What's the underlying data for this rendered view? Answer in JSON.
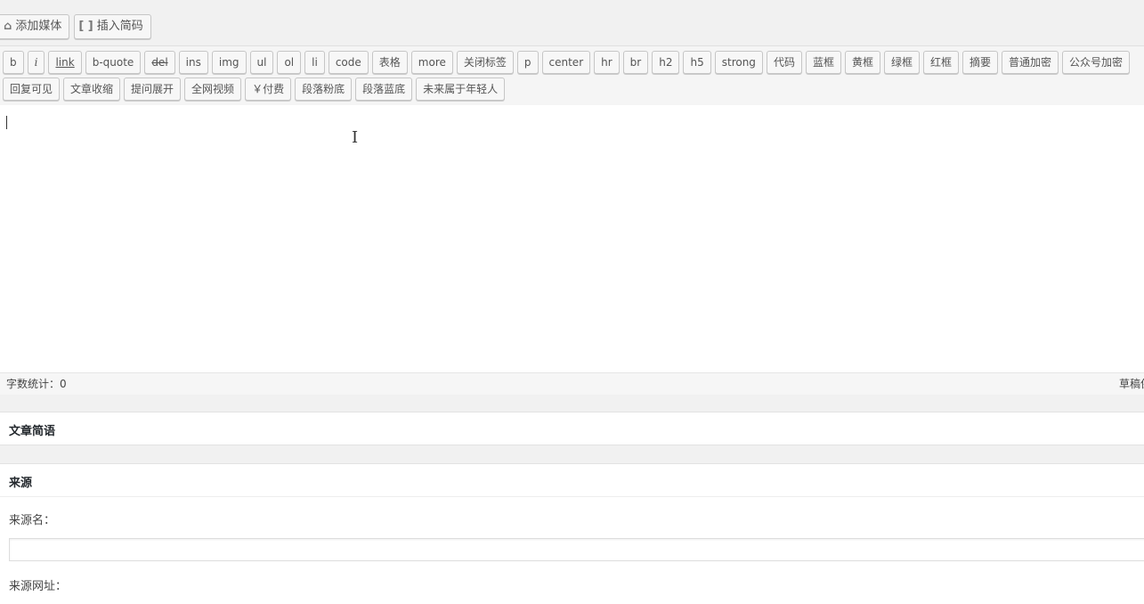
{
  "media_buttons": {
    "add_media": "添加媒体",
    "add_media_icon": "media-icon",
    "insert_shortcode": "插入简码",
    "shortcode_icon": "shortcode-bracket-icon"
  },
  "quicktags": {
    "row1": [
      "b",
      "i",
      "link",
      "b-quote",
      "del",
      "ins",
      "img",
      "ul",
      "ol",
      "li",
      "code",
      "表格",
      "more",
      "关闭标签",
      "p",
      "center",
      "hr",
      "br",
      "h2",
      "h5",
      "strong",
      "代码",
      "蓝框",
      "黄框",
      "绿框",
      "红框",
      "摘要",
      "普通加密",
      "公众号加密"
    ],
    "row2": [
      "回复可见",
      "文章收缩",
      "提问展开",
      "全网视频",
      "￥付费",
      "段落粉底",
      "段落蓝底",
      "未来属于年轻人"
    ]
  },
  "status_bar": {
    "word_count": "字数统计：0",
    "draft": "草稿保"
  },
  "excerpt_box": {
    "title": "文章简语"
  },
  "source_box": {
    "title": "来源",
    "name_label": "来源名：",
    "name_value": "",
    "url_label": "来源网址："
  }
}
